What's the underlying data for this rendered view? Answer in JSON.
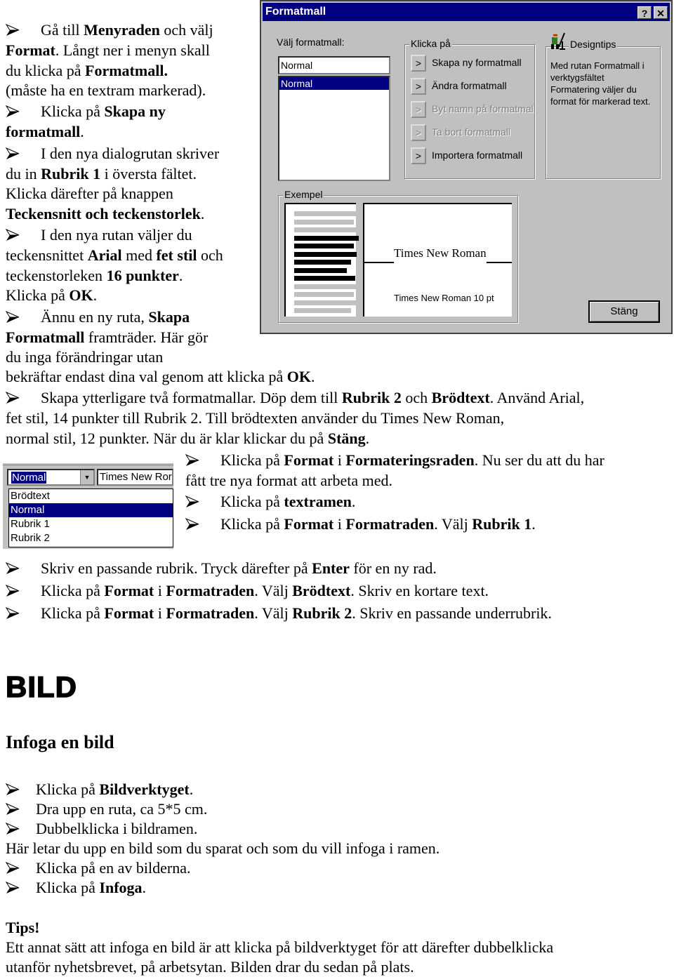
{
  "dialog": {
    "title": "Formatmall",
    "help_button": "?",
    "close_button": "✕",
    "select_label": "Välj formatmall:",
    "style_input_value": "Normal",
    "style_list": [
      "Normal"
    ],
    "actions_legend": "Klicka på",
    "actions": [
      {
        "arrow": ">",
        "label": "Skapa ny formatmall",
        "enabled": true
      },
      {
        "arrow": ">",
        "label": "Ändra formatmall",
        "enabled": true
      },
      {
        "arrow": ">",
        "label": "Byt namn på formatmall",
        "enabled": false
      },
      {
        "arrow": ">",
        "label": "Ta bort formatmall",
        "enabled": false
      },
      {
        "arrow": ">",
        "label": "Importera formatmall",
        "enabled": true
      }
    ],
    "tips_legend": "Designtips",
    "tips_text": "Med rutan Formatmall i verktygsfältet Formatering väljer du format för markerad text.",
    "example_legend": "Exempel",
    "preview_font_name": "Times New Roman",
    "preview_font_caption": "Times New Roman 10 pt",
    "close_label": "Stäng"
  },
  "toolbar": {
    "style_value": "Normal",
    "font_value": "Times New Ror",
    "dropdown_arrow": "▼",
    "style_options": [
      "Brödtext",
      "Normal",
      "Rubrik 1",
      "Rubrik 2"
    ],
    "selected_option": "Normal"
  },
  "steps_top": [
    [
      {
        "t": "Gå till "
      },
      {
        "t": "Menyraden",
        "b": true
      },
      {
        "t": " och välj"
      }
    ],
    [
      {
        "t": "Format",
        "b": true
      },
      {
        "t": ". Långt ner i menyn skall"
      }
    ],
    [
      {
        "t": "du klicka på "
      },
      {
        "t": "Formatmall.",
        "b": true
      }
    ],
    [
      {
        "t": "(måste ha en textram markerad)."
      }
    ],
    [
      {
        "t": "Klicka på "
      },
      {
        "t": "Skapa ny",
        "b": true
      }
    ],
    [
      {
        "t": "formatmall",
        "b": true
      },
      {
        "t": "."
      }
    ],
    [
      {
        "t": "I den nya dialogrutan skriver"
      }
    ],
    [
      {
        "t": "du in "
      },
      {
        "t": "Rubrik 1",
        "b": true
      },
      {
        "t": " i översta fältet."
      }
    ],
    [
      {
        "t": "Klicka därefter på knappen"
      }
    ],
    [
      {
        "t": "Teckensnitt och teckenstorlek",
        "b": true
      },
      {
        "t": "."
      }
    ],
    [
      {
        "t": "I den nya rutan väljer du"
      }
    ],
    [
      {
        "t": "teckensnittet "
      },
      {
        "t": "Arial",
        "b": true
      },
      {
        "t": " med "
      },
      {
        "t": "fet stil",
        "b": true
      },
      {
        "t": " och"
      }
    ],
    [
      {
        "t": "teckenstorleken "
      },
      {
        "t": "16 punkter",
        "b": true
      },
      {
        "t": "."
      }
    ],
    [
      {
        "t": "Klicka på "
      },
      {
        "t": "OK",
        "b": true
      },
      {
        "t": "."
      }
    ],
    [
      {
        "t": "Ännu en ny ruta, "
      },
      {
        "t": "Skapa",
        "b": true
      }
    ],
    [
      {
        "t": "Formatmall",
        "b": true
      },
      {
        "t": " framträder. Här gör"
      }
    ],
    [
      {
        "t": "du inga förändringar utan"
      }
    ],
    [
      {
        "t": "bekräftar endast dina val genom att klicka på "
      },
      {
        "t": "OK",
        "b": true
      },
      {
        "t": "."
      }
    ],
    [
      {
        "t": "Skapa ytterligare två formatmallar. Döp dem till "
      },
      {
        "t": "Rubrik 2",
        "b": true
      },
      {
        "t": " och "
      },
      {
        "t": "Brödtext",
        "b": true
      },
      {
        "t": ". Använd Arial,"
      }
    ],
    [
      {
        "t": "fet stil, 14 punkter till Rubrik 2. Till brödtexten använder du Times New Roman,"
      }
    ],
    [
      {
        "t": "normal stil, 12 punkter. När du är klar klickar du på "
      },
      {
        "t": "Stäng",
        "b": true
      },
      {
        "t": "."
      }
    ]
  ],
  "steps_mid": [
    [
      {
        "t": "Klicka på "
      },
      {
        "t": "Format",
        "b": true
      },
      {
        "t": " i "
      },
      {
        "t": "Formateringsraden",
        "b": true
      },
      {
        "t": ". Nu ser du att du har"
      }
    ],
    [
      {
        "t": "fått tre nya format att arbeta med."
      }
    ],
    [
      {
        "t": "Klicka på "
      },
      {
        "t": "textramen",
        "b": true
      },
      {
        "t": "."
      }
    ],
    [
      {
        "t": "Klicka på "
      },
      {
        "t": "Format",
        "b": true
      },
      {
        "t": " i "
      },
      {
        "t": "Formatraden",
        "b": true
      },
      {
        "t": ". Välj "
      },
      {
        "t": "Rubrik 1",
        "b": true
      },
      {
        "t": "."
      }
    ]
  ],
  "steps_low": [
    [
      {
        "t": "Skriv en passande rubrik. Tryck därefter på "
      },
      {
        "t": "Enter",
        "b": true
      },
      {
        "t": " för en ny rad."
      }
    ],
    [
      {
        "t": "Klicka på "
      },
      {
        "t": "Format",
        "b": true
      },
      {
        "t": " i "
      },
      {
        "t": "Formatraden",
        "b": true
      },
      {
        "t": ". Välj "
      },
      {
        "t": "Brödtext",
        "b": true
      },
      {
        "t": ". Skriv en kortare text."
      }
    ],
    [
      {
        "t": "Klicka på "
      },
      {
        "t": "Format",
        "b": true
      },
      {
        "t": " i "
      },
      {
        "t": "Formatraden",
        "b": true
      },
      {
        "t": ". Välj "
      },
      {
        "t": "Rubrik 2",
        "b": true
      },
      {
        "t": ". Skriv en passande underrubrik."
      }
    ]
  ],
  "section_title": "BILD",
  "subsection_title": "Infoga en bild",
  "steps_bild": [
    [
      {
        "t": "Klicka på "
      },
      {
        "t": "Bildverktyget",
        "b": true
      },
      {
        "t": "."
      }
    ],
    [
      {
        "t": "Dra upp en ruta, ca 5*5 cm."
      }
    ],
    [
      {
        "t": "Dubbelklicka i bildramen."
      }
    ],
    [
      {
        "t": "Här letar du upp en bild som du sparat  och som du vill infoga i ramen."
      }
    ],
    [
      {
        "t": "Klicka på en av bilderna."
      }
    ],
    [
      {
        "t": "Klicka på "
      },
      {
        "t": "Infoga",
        "b": true
      },
      {
        "t": "."
      }
    ]
  ],
  "tips": {
    "title": "Tips!",
    "lines": [
      "Ett annat sätt att infoga en bild är att klicka på bildverktyget för att därefter dubbelklicka",
      "utanför nyhetsbrevet, på arbetsytan. Bilden drar du sedan på plats."
    ]
  }
}
